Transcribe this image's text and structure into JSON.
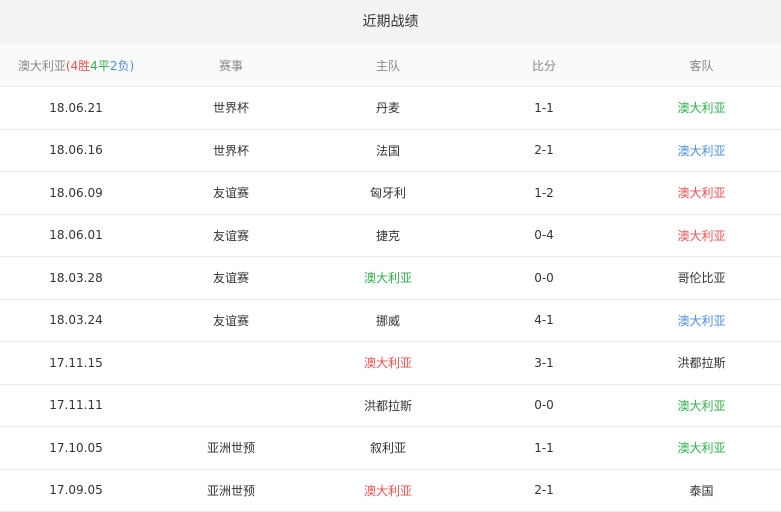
{
  "title": "近期战绩",
  "header": {
    "team": "澳大利亚",
    "open": "(",
    "wins": "4",
    "win_label": "胜",
    "draws": "4",
    "draw_label": "平",
    "losses": "2",
    "loss_label": "负",
    "close": ")",
    "competition": "赛事",
    "home": "主队",
    "score": "比分",
    "away": "客队"
  },
  "colors": {
    "win": "#2fb14b",
    "draw": "#4a90e2",
    "loss": "#f0504f"
  },
  "matches": [
    {
      "date": "18.06.21",
      "competition": "世界杯",
      "home": "丹麦",
      "home_result": "",
      "score": "1-1",
      "away": "澳大利亚",
      "away_result": "win"
    },
    {
      "date": "18.06.16",
      "competition": "世界杯",
      "home": "法国",
      "home_result": "",
      "score": "2-1",
      "away": "澳大利亚",
      "away_result": "draw"
    },
    {
      "date": "18.06.09",
      "competition": "友谊赛",
      "home": "匈牙利",
      "home_result": "",
      "score": "1-2",
      "away": "澳大利亚",
      "away_result": "loss"
    },
    {
      "date": "18.06.01",
      "competition": "友谊赛",
      "home": "捷克",
      "home_result": "",
      "score": "0-4",
      "away": "澳大利亚",
      "away_result": "loss"
    },
    {
      "date": "18.03.28",
      "competition": "友谊赛",
      "home": "澳大利亚",
      "home_result": "win",
      "score": "0-0",
      "away": "哥伦比亚",
      "away_result": ""
    },
    {
      "date": "18.03.24",
      "competition": "友谊赛",
      "home": "挪威",
      "home_result": "",
      "score": "4-1",
      "away": "澳大利亚",
      "away_result": "draw"
    },
    {
      "date": "17.11.15",
      "competition": "",
      "home": "澳大利亚",
      "home_result": "loss",
      "score": "3-1",
      "away": "洪都拉斯",
      "away_result": ""
    },
    {
      "date": "17.11.11",
      "competition": "",
      "home": "洪都拉斯",
      "home_result": "",
      "score": "0-0",
      "away": "澳大利亚",
      "away_result": "win"
    },
    {
      "date": "17.10.05",
      "competition": "亚洲世预",
      "home": "叙利亚",
      "home_result": "",
      "score": "1-1",
      "away": "澳大利亚",
      "away_result": "win"
    },
    {
      "date": "17.09.05",
      "competition": "亚洲世预",
      "home": "澳大利亚",
      "home_result": "loss",
      "score": "2-1",
      "away": "泰国",
      "away_result": ""
    }
  ]
}
